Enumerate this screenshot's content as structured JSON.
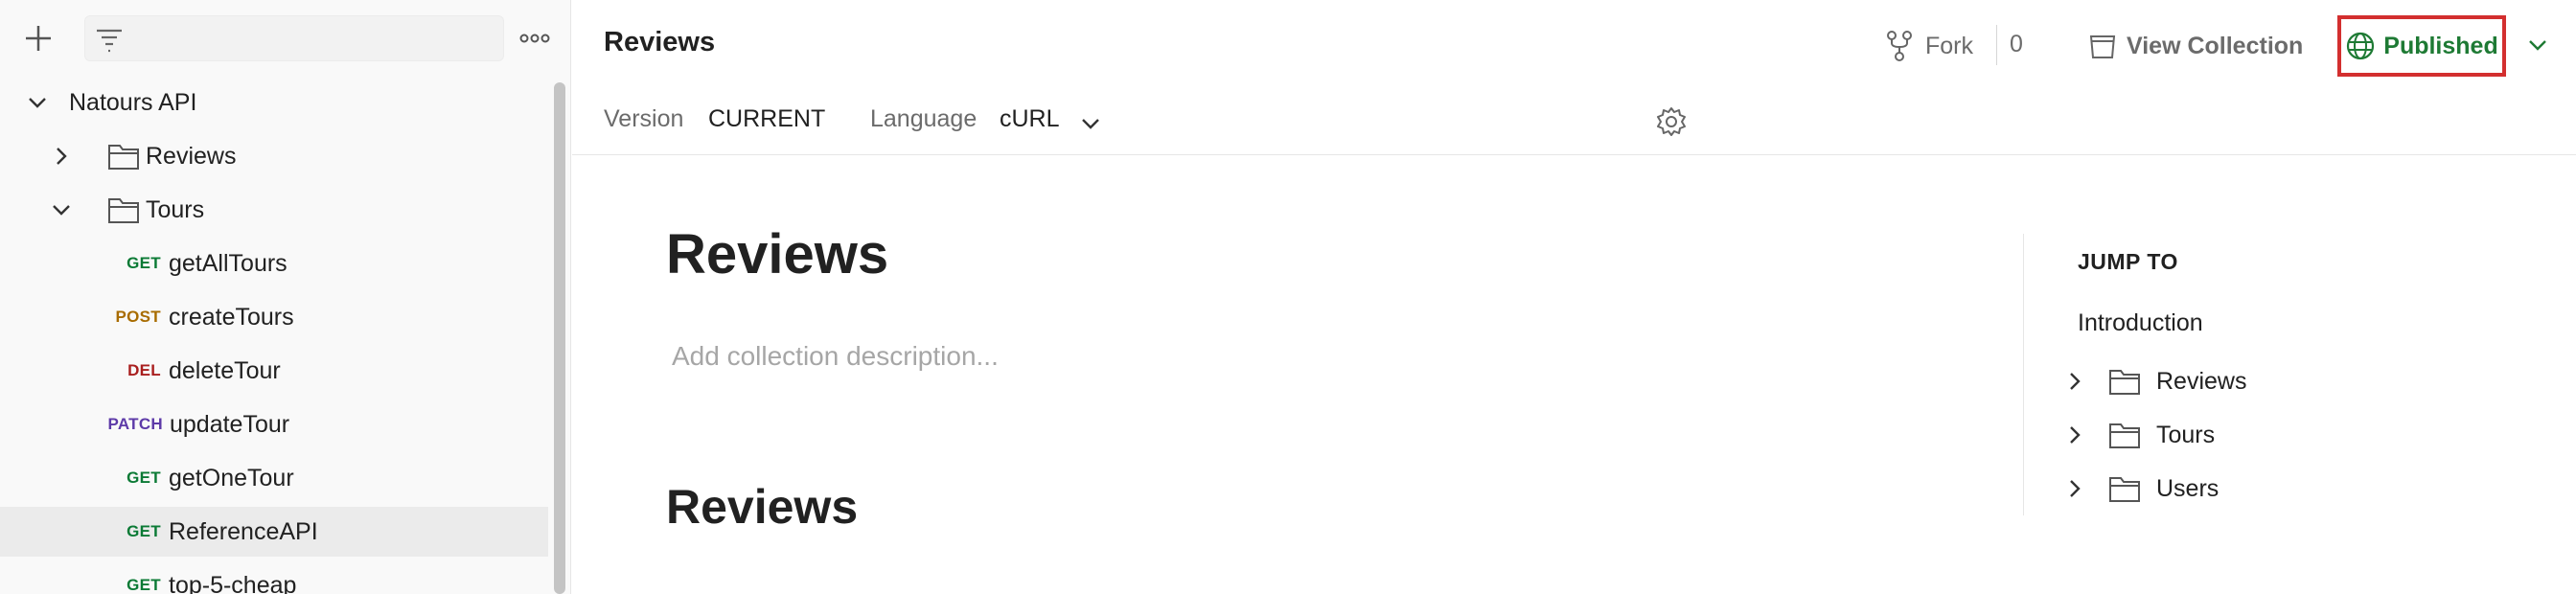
{
  "sidebar": {
    "collection": "Natours API",
    "folders": {
      "reviews": "Reviews",
      "tours": "Tours"
    },
    "requests": [
      {
        "method": "GET",
        "name": "getAllTours"
      },
      {
        "method": "POST",
        "name": "createTours"
      },
      {
        "method": "DEL",
        "name": "deleteTour"
      },
      {
        "method": "PATCH",
        "name": "updateTour"
      },
      {
        "method": "GET",
        "name": "getOneTour"
      },
      {
        "method": "GET",
        "name": "ReferenceAPI"
      },
      {
        "method": "GET",
        "name": "top-5-cheap"
      }
    ]
  },
  "header": {
    "title": "Reviews",
    "fork_label": "Fork",
    "fork_count": "0",
    "view_collection_label": "View Collection",
    "published_label": "Published",
    "version_label": "Version",
    "version_value": "CURRENT",
    "language_label": "Language",
    "language_value": "cURL"
  },
  "main": {
    "heading": "Reviews",
    "description_placeholder": "Add collection description...",
    "section_heading": "Reviews"
  },
  "jump_to": {
    "title": "JUMP TO",
    "intro": "Introduction",
    "items": [
      "Reviews",
      "Tours",
      "Users"
    ]
  },
  "colors": {
    "published_green": "#1e7a34",
    "highlight_red": "#d32f2f",
    "get": "#0b7a35",
    "post": "#a86c00",
    "del": "#a91f1f",
    "patch": "#5d3aa8"
  }
}
